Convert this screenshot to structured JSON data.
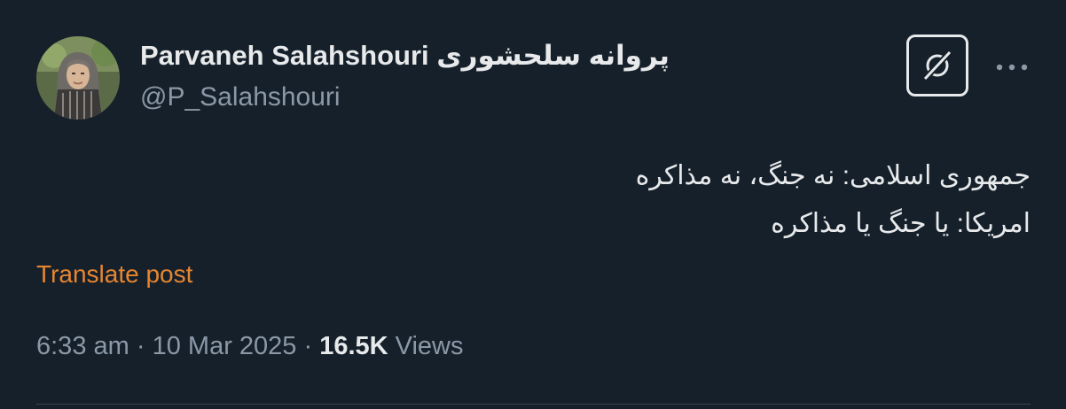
{
  "author": {
    "display_name": "Parvaneh Salahshouri",
    "display_name_fa": "پروانه سلحشوری",
    "handle": "@P_Salahshouri"
  },
  "icons": {
    "grok": "grok-icon",
    "more": "more-icon"
  },
  "post": {
    "lines": [
      "جمهوری اسلامی: نه جنگ، نه مذاکره",
      "امریکا: یا جنگ یا مذاکره"
    ]
  },
  "translate_label": "Translate post",
  "meta": {
    "time": "6:33 am",
    "date": "10 Mar 2025",
    "views_count": "16.5K",
    "views_label": "Views",
    "separator": "·"
  },
  "colors": {
    "background": "#15202b",
    "primary_text": "#e7e9ea",
    "secondary_text": "#8b98a5",
    "translate_link": "#e8862f"
  }
}
